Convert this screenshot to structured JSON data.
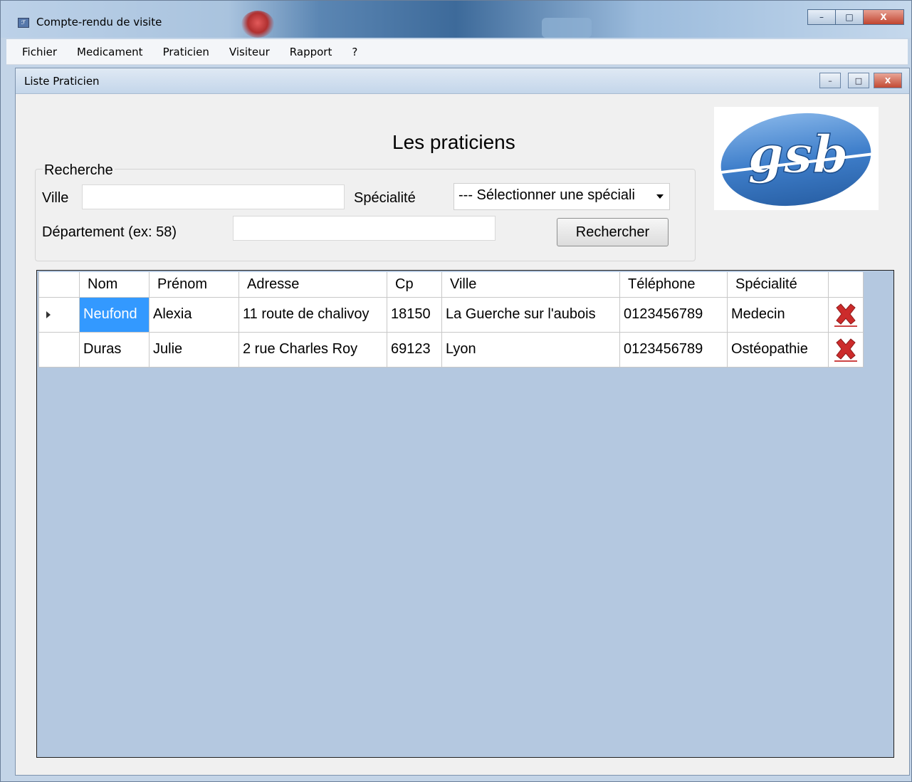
{
  "window": {
    "title": "Compte-rendu de visite",
    "min": "–",
    "max": "□",
    "close": "X"
  },
  "menu": [
    "Fichier",
    "Medicament",
    "Praticien",
    "Visiteur",
    "Rapport",
    "?"
  ],
  "child": {
    "title": "Liste Praticien",
    "min": "–",
    "max": "□",
    "close": "X"
  },
  "heading": "Les praticiens",
  "logo": {
    "text": "gsb"
  },
  "search": {
    "group_label": "Recherche",
    "ville_label": "Ville",
    "ville_value": "",
    "specialite_label": "Spécialité",
    "specialite_selected": "--- Sélectionner une spéciali",
    "departement_label": "Département (ex: 58)",
    "departement_value": "",
    "button": "Rechercher"
  },
  "grid": {
    "columns": [
      "Nom",
      "Prénom",
      "Adresse",
      "Cp",
      "Ville",
      "Téléphone",
      "Spécialité"
    ],
    "rows": [
      [
        "Neufond",
        "Alexia",
        "11 route de chalivoy",
        "18150",
        "La Guerche  sur l'aubois",
        "0123456789",
        "Medecin"
      ],
      [
        "Duras",
        "Julie",
        "2 rue Charles Roy",
        "69123",
        "Lyon",
        "0123456789",
        "Ostéopathie"
      ]
    ],
    "delete_icon": "delete-x-icon"
  },
  "colors": {
    "selection": "#3399ff",
    "grid_bg": "#b4c8e0",
    "delete_red": "#cc2b2b"
  }
}
